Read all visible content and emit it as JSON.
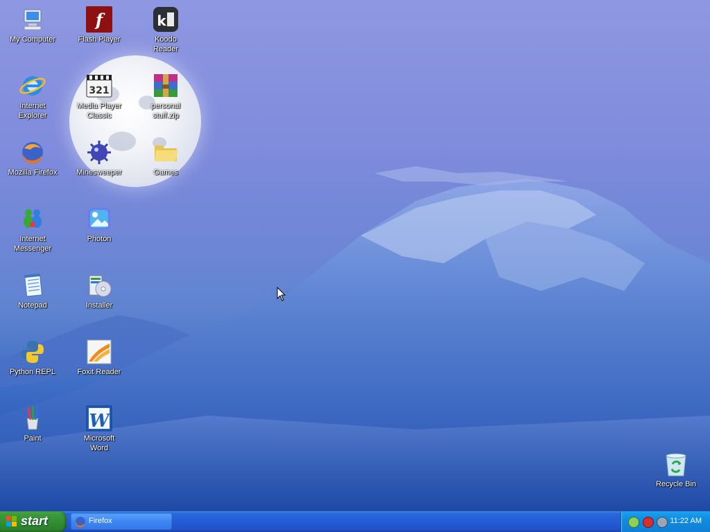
{
  "desktop": {
    "icons": [
      {
        "id": "my-computer",
        "label": "My Computer",
        "icon": "computer-icon"
      },
      {
        "id": "flash-player",
        "label": "Flash Player",
        "icon": "flash-icon"
      },
      {
        "id": "koodo-reader",
        "label": "Koodo\nReader",
        "icon": "koodo-icon"
      },
      {
        "id": "internet-explorer",
        "label": "Internet\nExplorer",
        "icon": "ie-icon"
      },
      {
        "id": "media-player-classic",
        "label": "Media Player\nClassic",
        "icon": "mpc-icon"
      },
      {
        "id": "personal-stuff",
        "label": "personal\nstuff.zip",
        "icon": "archive-icon"
      },
      {
        "id": "mozilla-firefox",
        "label": "Mozilla Firefox",
        "icon": "firefox-icon"
      },
      {
        "id": "minesweeper",
        "label": "Minesweeper",
        "icon": "mine-icon"
      },
      {
        "id": "games",
        "label": "Games",
        "icon": "folder-icon"
      },
      {
        "id": "internet-messenger",
        "label": "Internet\nMessenger",
        "icon": "messenger-icon"
      },
      {
        "id": "photon",
        "label": "Photon",
        "icon": "photon-icon"
      },
      {
        "id": "notepad",
        "label": "Notepad",
        "icon": "notepad-icon"
      },
      {
        "id": "installer",
        "label": "Installer",
        "icon": "installer-icon"
      },
      {
        "id": "python-repl",
        "label": "Python REPL",
        "icon": "python-icon"
      },
      {
        "id": "foxit-reader",
        "label": "Foxit Reader",
        "icon": "foxit-icon"
      },
      {
        "id": "paint",
        "label": "Paint",
        "icon": "paint-icon"
      },
      {
        "id": "microsoft-word",
        "label": "Microsoft\nWord",
        "icon": "word-icon"
      },
      {
        "id": "recycle-bin",
        "label": "Recycle Bin",
        "icon": "recycle-bin-icon"
      }
    ]
  },
  "taskbar": {
    "start_label": "start",
    "tasks": [
      {
        "label": "Firefox",
        "icon": "firefox-icon"
      }
    ],
    "tray_icons": [
      "network-icon",
      "security-shield-icon",
      "volume-icon"
    ],
    "clock": "11:22 AM"
  },
  "colors": {
    "taskbar": "#245dd6",
    "start_button": "#3c9a3c",
    "tray": "#118ce0",
    "label_text": "#ffffff"
  }
}
